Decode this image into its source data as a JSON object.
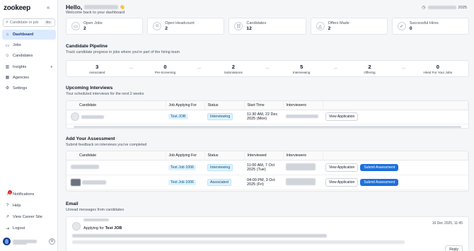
{
  "app": {
    "logo": "zookeep"
  },
  "sidebar": {
    "search_placeholder": "Candidate or job",
    "search_shortcut": "⌘K",
    "items": [
      {
        "label": "Dashboard",
        "icon": "home-icon"
      },
      {
        "label": "Jobs",
        "icon": "briefcase-icon"
      },
      {
        "label": "Candidates",
        "icon": "users-icon"
      },
      {
        "label": "Insights",
        "icon": "chart-icon"
      },
      {
        "label": "Agencies",
        "icon": "building-icon"
      },
      {
        "label": "Settings",
        "icon": "gear-icon"
      }
    ],
    "bottom": [
      {
        "label": "Notifications",
        "icon": "bell-icon",
        "badge": "1"
      },
      {
        "label": "Help",
        "icon": "help-icon"
      },
      {
        "label": "View Career Site",
        "icon": "external-link-icon"
      },
      {
        "label": "Logout",
        "icon": "logout-icon"
      }
    ]
  },
  "header": {
    "hello": "Hello,",
    "wave": "👋",
    "welcome": "Welcome back to your dashboard",
    "date_year": "2025"
  },
  "stats": [
    {
      "label": "Open Jobs",
      "value": "2",
      "icon": "briefcase-icon"
    },
    {
      "label": "Open Headcount",
      "value": "2",
      "icon": "user-icon"
    },
    {
      "label": "Candidates",
      "value": "12",
      "icon": "users-icon"
    },
    {
      "label": "Offers Made",
      "value": "2",
      "icon": "offer-icon"
    },
    {
      "label": "Successful Hires",
      "value": "0",
      "icon": "check-icon"
    }
  ],
  "pipeline": {
    "title": "Candidate Pipeline",
    "subtitle": "Track candidate progress in jobs where you're part of the hiring team",
    "stages": [
      {
        "value": "3",
        "label": "Associated"
      },
      {
        "value": "0",
        "label": "Pre-Screening"
      },
      {
        "value": "2",
        "label": "Submissions"
      },
      {
        "value": "5",
        "label": "Interviewing"
      },
      {
        "value": "2",
        "label": "Offering"
      },
      {
        "value": "0",
        "label": "Hired For Your Jobs"
      }
    ]
  },
  "upcoming": {
    "title": "Upcoming Interviews",
    "subtitle": "Your scheduled interviews for the next 2 weeks",
    "columns": [
      "Candidate",
      "Job Applying For",
      "Status",
      "Start Time",
      "Interviewers",
      ""
    ],
    "rows": [
      {
        "job": "Test JOB",
        "status": "Interviewing",
        "start1": "11:30 AM, 22 Dec",
        "start2": "2025 (Mon)",
        "action": "View Application"
      }
    ]
  },
  "assessment": {
    "title": "Add Your Assessment",
    "subtitle": "Submit feedback on interviews you've completed",
    "columns": [
      "Candidate",
      "Job Applying For",
      "Status",
      "Interviewed",
      "Interviewers",
      ""
    ],
    "rows": [
      {
        "job": "Test Job 1006",
        "status": "Interviewing",
        "int1": "11:00 AM, 7 Oct",
        "int2": "2025 (Tue)",
        "view": "View Application",
        "submit": "Submit Assessment"
      },
      {
        "job": "Test Job 1006",
        "status": "Associated",
        "int1": "04:00 PM, 3 Oct",
        "int2": "2025 (Fri)",
        "view": "View Application",
        "submit": "Submit Assessment"
      }
    ]
  },
  "email": {
    "title": "Email",
    "subtitle": "Unread messages from candidates",
    "from_prefix": "Applying for",
    "job": "Test JOB",
    "date": "16 Dec 2025, 11:45",
    "reply": "Reply"
  }
}
